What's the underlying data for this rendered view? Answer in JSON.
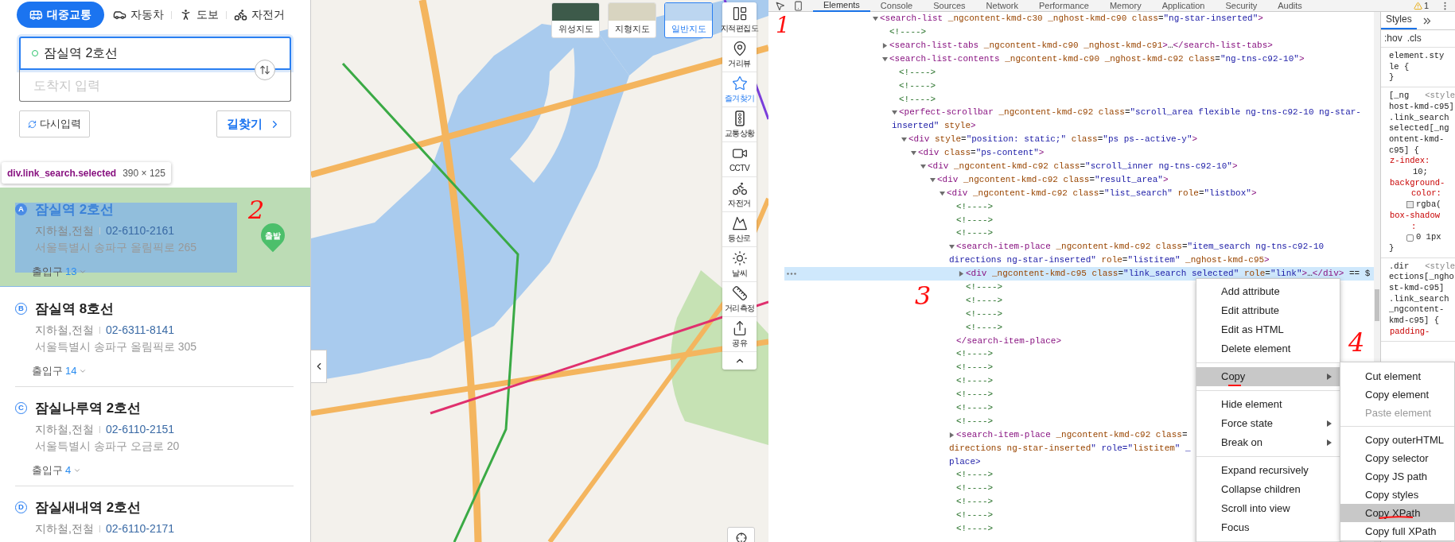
{
  "route_panel": {
    "modes": [
      {
        "label": "대중교통",
        "selected": true
      },
      {
        "label": "자동차",
        "selected": false
      },
      {
        "label": "도보",
        "selected": false
      },
      {
        "label": "자전거",
        "selected": false
      }
    ],
    "start": {
      "value": "잠실역 2호선"
    },
    "destination": {
      "placeholder": "도착지 입력"
    },
    "reset_button": "다시입력",
    "search_button": "길찾기",
    "inspect_tooltip": {
      "selector": "div.link_search.selected",
      "size": "390 × 125"
    },
    "results": [
      {
        "badge": "A",
        "name": "잠실역 2호선",
        "category": "지하철,전철",
        "phone": "02-6110-2161",
        "address": "서울특별시 송파구 올림픽로 265",
        "exit_label": "출입구",
        "exit_count": "13",
        "pin": "출발",
        "selected": true,
        "highlighted": true
      },
      {
        "badge": "B",
        "name": "잠실역 8호선",
        "category": "지하철,전철",
        "phone": "02-6311-8141",
        "address": "서울특별시 송파구 올림픽로 305",
        "exit_label": "출입구",
        "exit_count": "14",
        "selected": false,
        "highlighted": false
      },
      {
        "badge": "C",
        "name": "잠실나루역 2호선",
        "category": "지하철,전철",
        "phone": "02-6110-2151",
        "address": "서울특별시 송파구 오금로 20",
        "exit_label": "출입구",
        "exit_count": "4",
        "selected": false,
        "highlighted": false
      },
      {
        "badge": "D",
        "name": "잠실새내역 2호선",
        "category": "지하철,전철",
        "phone": "02-6110-2171",
        "selected": false,
        "highlighted": false
      }
    ]
  },
  "map": {
    "types": [
      {
        "label": "위성지도",
        "selected": false
      },
      {
        "label": "지형지도",
        "selected": false
      },
      {
        "label": "일반지도",
        "selected": true
      }
    ],
    "tools": [
      {
        "label": "지적편집도",
        "active": false
      },
      {
        "label": "거리뷰",
        "active": false
      },
      {
        "label": "즐겨찾기",
        "active": true
      },
      {
        "label": "교통상황",
        "active": false
      },
      {
        "label": "CCTV",
        "active": false
      },
      {
        "label": "자전거",
        "active": false
      },
      {
        "label": "등산로",
        "active": false
      },
      {
        "label": "날씨",
        "active": false
      },
      {
        "label": "거리측정",
        "active": false
      },
      {
        "label": "공유",
        "active": false
      }
    ]
  },
  "devtools": {
    "tabs": [
      {
        "label": "Elements",
        "selected": true
      },
      {
        "label": "Console",
        "selected": false
      },
      {
        "label": "Sources",
        "selected": false
      },
      {
        "label": "Network",
        "selected": false
      },
      {
        "label": "Performance",
        "selected": false
      },
      {
        "label": "Memory",
        "selected": false
      },
      {
        "label": "Application",
        "selected": false
      },
      {
        "label": "Security",
        "selected": false
      },
      {
        "label": "Audits",
        "selected": false
      }
    ],
    "warning_count": "1",
    "tree": [
      {
        "kind": "element",
        "lines": [
          "<search-list _ngcontent-kmd-c30 _nghost-kmd-c90 class=\"ng-star-inserted\">"
        ],
        "expanded": true,
        "selected": false,
        "children": [
          {
            "kind": "comment",
            "lines": [
              "<!---->"
            ],
            "selected": false
          },
          {
            "kind": "element",
            "lines": [
              "<search-list-tabs _ngcontent-kmd-c90 _nghost-kmd-c91>…</search-list-tabs>"
            ],
            "expanded": false,
            "selected": false
          },
          {
            "kind": "element",
            "lines": [
              "<search-list-contents _ngcontent-kmd-c90 _nghost-kmd-c92 class=\"ng-tns-c92-10\">"
            ],
            "expanded": true,
            "selected": false,
            "children": [
              {
                "kind": "comment",
                "lines": [
                  "<!---->"
                ],
                "selected": false
              },
              {
                "kind": "comment",
                "lines": [
                  "<!---->"
                ],
                "selected": false
              },
              {
                "kind": "comment",
                "lines": [
                  "<!---->"
                ],
                "selected": false
              },
              {
                "kind": "element",
                "lines": [
                  "<perfect-scrollbar _ngcontent-kmd-c92 class=\"scroll_area flexible ng-tns-c92-10 ng-star-",
                  "inserted\" style>"
                ],
                "expanded": true,
                "selected": false,
                "children": [
                  {
                    "kind": "element",
                    "lines": [
                      "<div style=\"position: static;\" class=\"ps ps--active-y\">"
                    ],
                    "expanded": true,
                    "selected": false,
                    "children": [
                      {
                        "kind": "element",
                        "lines": [
                          "<div class=\"ps-content\">"
                        ],
                        "expanded": true,
                        "selected": false,
                        "children": [
                          {
                            "kind": "element",
                            "lines": [
                              "<div _ngcontent-kmd-c92 class=\"scroll_inner ng-tns-c92-10\">"
                            ],
                            "expanded": true,
                            "selected": false,
                            "children": [
                              {
                                "kind": "element",
                                "lines": [
                                  "<div _ngcontent-kmd-c92 class=\"result_area\">"
                                ],
                                "expanded": true,
                                "selected": false,
                                "children": [
                                  {
                                    "kind": "element",
                                    "lines": [
                                      "<div _ngcontent-kmd-c92 class=\"list_search\" role=\"listbox\">"
                                    ],
                                    "expanded": true,
                                    "selected": false,
                                    "children": [
                                      {
                                        "kind": "comment",
                                        "lines": [
                                          "<!---->"
                                        ],
                                        "selected": false
                                      },
                                      {
                                        "kind": "comment",
                                        "lines": [
                                          "<!---->"
                                        ],
                                        "selected": false
                                      },
                                      {
                                        "kind": "comment",
                                        "lines": [
                                          "<!---->"
                                        ],
                                        "selected": false
                                      },
                                      {
                                        "kind": "element",
                                        "lines": [
                                          "<search-item-place _ngcontent-kmd-c92 class=\"item_search ng-tns-c92-10",
                                          "directions ng-star-inserted\" role=\"listitem\" _nghost-kmd-c95>"
                                        ],
                                        "expanded": true,
                                        "selected": false,
                                        "close": "</search-item-place>",
                                        "children": [
                                          {
                                            "kind": "element",
                                            "lines": [
                                              "<div _ngcontent-kmd-c95 class=\"link_search selected\" role=\"link\">…</div> == $"
                                            ],
                                            "expanded": false,
                                            "selected": true
                                          },
                                          {
                                            "kind": "comment",
                                            "lines": [
                                              "<!---->"
                                            ],
                                            "selected": false
                                          },
                                          {
                                            "kind": "comment",
                                            "lines": [
                                              "<!---->"
                                            ],
                                            "selected": false
                                          },
                                          {
                                            "kind": "comment",
                                            "lines": [
                                              "<!---->"
                                            ],
                                            "selected": false
                                          },
                                          {
                                            "kind": "comment",
                                            "lines": [
                                              "<!---->"
                                            ],
                                            "selected": false
                                          }
                                        ]
                                      },
                                      {
                                        "kind": "comment",
                                        "lines": [
                                          "<!---->"
                                        ],
                                        "selected": false
                                      },
                                      {
                                        "kind": "comment",
                                        "lines": [
                                          "<!---->"
                                        ],
                                        "selected": false
                                      },
                                      {
                                        "kind": "comment",
                                        "lines": [
                                          "<!---->"
                                        ],
                                        "selected": false
                                      },
                                      {
                                        "kind": "comment",
                                        "lines": [
                                          "<!---->"
                                        ],
                                        "selected": false
                                      },
                                      {
                                        "kind": "comment",
                                        "lines": [
                                          "<!---->"
                                        ],
                                        "selected": false
                                      },
                                      {
                                        "kind": "comment",
                                        "lines": [
                                          "<!---->"
                                        ],
                                        "selected": false
                                      },
                                      {
                                        "kind": "element",
                                        "lines": [
                                          "<search-item-place _ngcontent-kmd-c92 class=",
                                          "directions ng-star-inserted\" role=\"listitem\" _",
                                          "place>"
                                        ],
                                        "expanded": false,
                                        "selected": false
                                      },
                                      {
                                        "kind": "comment",
                                        "lines": [
                                          "<!---->"
                                        ],
                                        "selected": false
                                      },
                                      {
                                        "kind": "comment",
                                        "lines": [
                                          "<!---->"
                                        ],
                                        "selected": false
                                      },
                                      {
                                        "kind": "comment",
                                        "lines": [
                                          "<!---->"
                                        ],
                                        "selected": false
                                      },
                                      {
                                        "kind": "comment",
                                        "lines": [
                                          "<!---->"
                                        ],
                                        "selected": false
                                      },
                                      {
                                        "kind": "comment",
                                        "lines": [
                                          "<!---->"
                                        ],
                                        "selected": false
                                      }
                                    ]
                                  }
                                ]
                              }
                            ]
                          }
                        ]
                      }
                    ]
                  }
                ]
              }
            ]
          }
        ]
      }
    ],
    "styles": {
      "tab": "Styles",
      "filters": [
        ":hov",
        ".cls"
      ],
      "rules": [
        [
          {
            "text": "element.sty",
            "kind": "selector"
          },
          {
            "text": "le {",
            "kind": "selector"
          },
          {
            "text": "}",
            "kind": "selector"
          }
        ],
        [
          {
            "text": "[_ng",
            "kind": "selector",
            "source": "<style"
          },
          {
            "text": "host-kmd-c95]",
            "kind": "selector"
          },
          {
            "text": ".link_search",
            "kind": "selector"
          },
          {
            "text": "selected[_ng",
            "kind": "selector"
          },
          {
            "text": "ontent-kmd-",
            "kind": "selector"
          },
          {
            "text": "c95] {",
            "kind": "selector"
          },
          {
            "text": "z-index:",
            "kind": "property"
          },
          {
            "text": "10;",
            "kind": "value"
          },
          {
            "text": "background-",
            "kind": "property"
          },
          {
            "text": "color:",
            "kind": "property-cont"
          },
          {
            "text": "rgba(",
            "kind": "color-value"
          },
          {
            "text": "box-shadow",
            "kind": "property"
          },
          {
            "text": ":",
            "kind": "property-cont"
          },
          {
            "text": "0 1px",
            "kind": "shadow-value"
          },
          {
            "text": "}",
            "kind": "selector"
          }
        ],
        [
          {
            "text": ".dir",
            "kind": "selector",
            "source": "<style"
          },
          {
            "text": "ections[_ngho",
            "kind": "selector"
          },
          {
            "text": "st-kmd-c95]",
            "kind": "selector"
          },
          {
            "text": ".link_search",
            "kind": "selector"
          },
          {
            "text": "_ngcontent-",
            "kind": "selector"
          },
          {
            "text": "kmd-c95] {",
            "kind": "selector"
          },
          {
            "text": "padding-",
            "kind": "property"
          }
        ]
      ]
    },
    "context_menu": [
      [
        {
          "label": "Add attribute",
          "highlighted": false,
          "has_submenu": false
        },
        {
          "label": "Edit attribute",
          "highlighted": false,
          "has_submenu": false
        },
        {
          "label": "Edit as HTML",
          "highlighted": false,
          "has_submenu": false
        },
        {
          "label": "Delete element",
          "highlighted": false,
          "has_submenu": false
        }
      ],
      [
        {
          "label": "Copy",
          "highlighted": true,
          "has_submenu": true
        }
      ],
      [
        {
          "label": "Hide element",
          "highlighted": false,
          "has_submenu": false
        },
        {
          "label": "Force state",
          "highlighted": false,
          "has_submenu": true
        },
        {
          "label": "Break on",
          "highlighted": false,
          "has_submenu": true
        }
      ],
      [
        {
          "label": "Expand recursively",
          "highlighted": false,
          "has_submenu": false
        },
        {
          "label": "Collapse children",
          "highlighted": false,
          "has_submenu": false
        },
        {
          "label": "Scroll into view",
          "highlighted": false,
          "has_submenu": false
        },
        {
          "label": "Focus",
          "highlighted": false,
          "has_submenu": false
        }
      ]
    ],
    "copy_submenu": [
      [
        {
          "label": "Cut element",
          "highlighted": false,
          "disabled": false
        },
        {
          "label": "Copy element",
          "highlighted": false,
          "disabled": false
        },
        {
          "label": "Paste element",
          "highlighted": false,
          "disabled": true
        }
      ],
      [
        {
          "label": "Copy outerHTML",
          "highlighted": false,
          "disabled": false
        },
        {
          "label": "Copy selector",
          "highlighted": false,
          "disabled": false
        },
        {
          "label": "Copy JS path",
          "highlighted": false,
          "disabled": false
        },
        {
          "label": "Copy styles",
          "highlighted": false,
          "disabled": false
        },
        {
          "label": "Copy XPath",
          "highlighted": true,
          "disabled": false
        },
        {
          "label": "Copy full XPath",
          "highlighted": false,
          "disabled": false
        }
      ]
    ]
  },
  "annotations": [
    "1",
    "2",
    "3",
    "4"
  ]
}
